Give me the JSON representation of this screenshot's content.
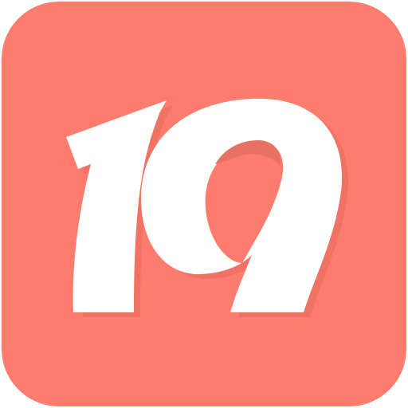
{
  "icon": {
    "name": "app-icon-19",
    "logo_text": "19",
    "colors": {
      "background": "#FE7C6D",
      "glyph": "#FFFFFF",
      "glyph_shadow": "#E66A5B",
      "counter_shade": "#E77264"
    }
  }
}
